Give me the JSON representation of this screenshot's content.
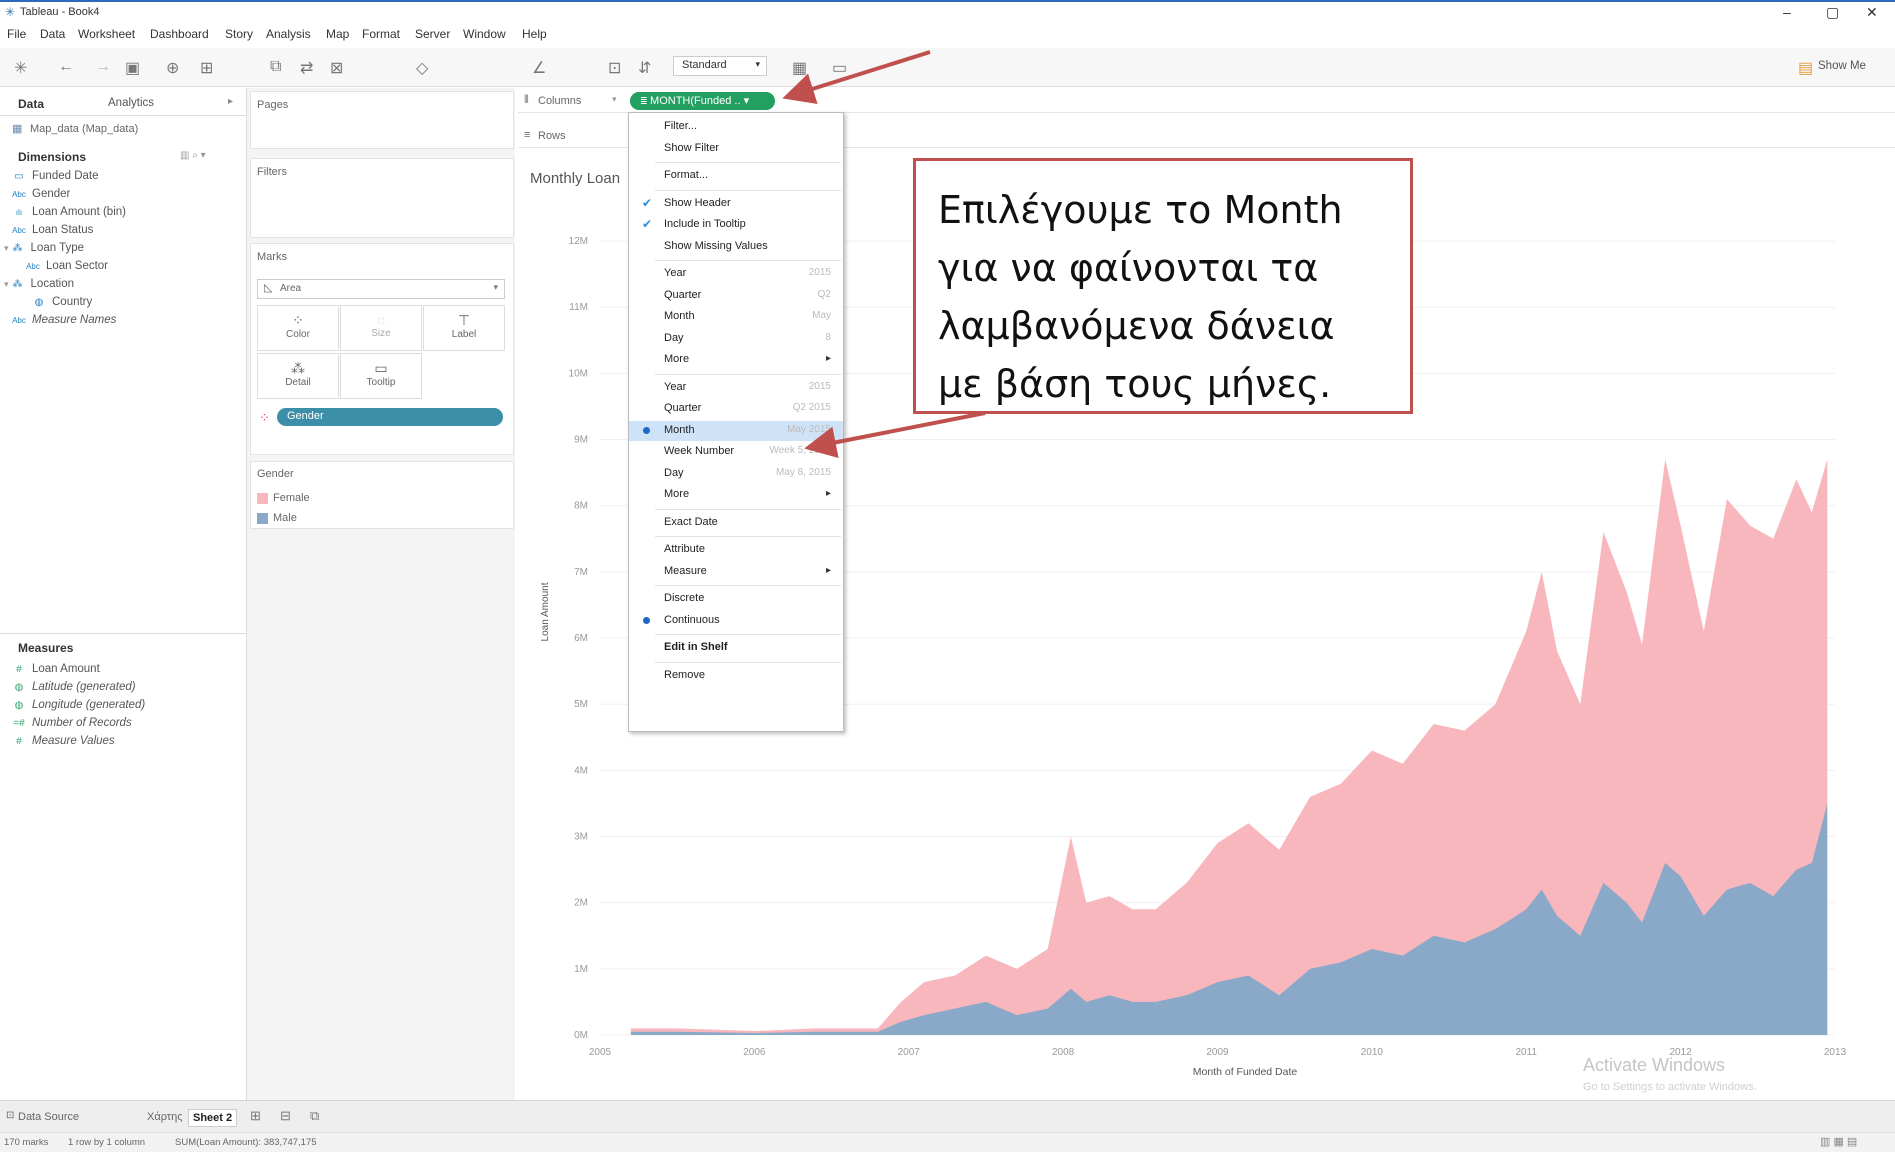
{
  "window": {
    "title": "Tableau - Book4",
    "minimize": "–",
    "maximize": "▢",
    "close": "✕"
  },
  "menu": [
    "File",
    "Data",
    "Worksheet",
    "Dashboard",
    "Story",
    "Analysis",
    "Map",
    "Format",
    "Server",
    "Window",
    "Help"
  ],
  "toolbar": {
    "fit_select": "Standard",
    "show_me": "Show Me"
  },
  "data_pane": {
    "tab_data": "Data",
    "tab_analytics": "Analytics",
    "datasource": "Map_data (Map_data)",
    "dimensions_title": "Dimensions",
    "dimensions": [
      {
        "icon": "calendar-icon",
        "glyph": "▭",
        "label": "Funded Date"
      },
      {
        "icon": "abc-icon",
        "glyph": "Abc",
        "label": "Gender"
      },
      {
        "icon": "bin-icon",
        "glyph": "ılı",
        "label": "Loan Amount (bin)"
      },
      {
        "icon": "abc-icon",
        "glyph": "Abc",
        "label": "Loan Status"
      },
      {
        "icon": "hierarchy-icon",
        "glyph": "⁂",
        "label": "Loan Type"
      },
      {
        "icon": "abc-icon",
        "glyph": "Abc",
        "label": "Loan Sector"
      },
      {
        "icon": "hierarchy-icon",
        "glyph": "⁂",
        "label": "Location"
      },
      {
        "icon": "globe-icon",
        "glyph": "◍",
        "label": "Country"
      },
      {
        "icon": "abc-icon",
        "glyph": "Abc",
        "label": "Measure Names"
      }
    ],
    "measures_title": "Measures",
    "measures": [
      {
        "icon": "hash-icon",
        "glyph": "#",
        "label": "Loan Amount"
      },
      {
        "icon": "globe-icon",
        "glyph": "◍",
        "label": "Latitude (generated)"
      },
      {
        "icon": "globe-icon",
        "glyph": "◍",
        "label": "Longitude (generated)"
      },
      {
        "icon": "hash-icon",
        "glyph": "=#",
        "label": "Number of Records"
      },
      {
        "icon": "hash-icon",
        "glyph": "#",
        "label": "Measure Values"
      }
    ]
  },
  "cards": {
    "pages": "Pages",
    "filters": "Filters",
    "marks": "Marks",
    "mark_type": "Area",
    "color": "Color",
    "size": "Size",
    "label": "Label",
    "detail": "Detail",
    "tooltip": "Tooltip",
    "gender_pill": "Gender",
    "legend_title": "Gender",
    "legend": [
      {
        "label": "Female",
        "color": "#f8b6bd"
      },
      {
        "label": "Male",
        "color": "#8aa9c8"
      }
    ]
  },
  "shelves": {
    "columns": "Columns",
    "rows": "Rows",
    "columns_pill": "MONTH(Funded ..  ▾"
  },
  "context_menu": {
    "items": [
      {
        "label": "Filter...",
        "check": ""
      },
      {
        "label": "Show Filter",
        "check": ""
      },
      {
        "label": "Format...",
        "check": ""
      },
      {
        "label": "Show Header",
        "check": "✔"
      },
      {
        "label": "Include in Tooltip",
        "check": "✔"
      },
      {
        "label": "Show Missing Values",
        "check": ""
      },
      {
        "label": "Year",
        "right": "2015"
      },
      {
        "label": "Quarter",
        "right": "Q2"
      },
      {
        "label": "Month",
        "right": "May"
      },
      {
        "label": "Day",
        "right": "8"
      },
      {
        "label": "More",
        "right": "▸"
      },
      {
        "label": "Year",
        "right": "2015"
      },
      {
        "label": "Quarter",
        "right": "Q2 2015"
      },
      {
        "label": "Month",
        "right": "May 2015",
        "selected": true
      },
      {
        "label": "Week Number",
        "right": "Week 5, 2015"
      },
      {
        "label": "Day",
        "right": "May 8, 2015"
      },
      {
        "label": "More",
        "right": "▸"
      },
      {
        "label": "Exact Date"
      },
      {
        "label": "Attribute"
      },
      {
        "label": "Measure",
        "right": "▸"
      },
      {
        "label": "Discrete"
      },
      {
        "label": "Continuous",
        "dot": true
      },
      {
        "label": "Edit in Shelf",
        "bold": true
      },
      {
        "label": "Remove"
      }
    ]
  },
  "callout": {
    "lines": [
      "Επιλέγουμε το Month",
      "για να φαίνονται τα",
      "λαμβανόμενα δάνεια",
      "με βάση τους μήνες."
    ]
  },
  "chart_data": {
    "type": "area",
    "title": "Monthly Loan",
    "xlabel": "Month of Funded Date",
    "ylabel": "Loan Amount",
    "x_ticks": [
      "2005",
      "2006",
      "2007",
      "2008",
      "2009",
      "2010",
      "2011",
      "2012",
      "2013"
    ],
    "y_ticks": [
      "0M",
      "1M",
      "2M",
      "3M",
      "4M",
      "5M",
      "6M",
      "7M",
      "8M",
      "9M",
      "10M",
      "11M",
      "12M"
    ],
    "ylim": [
      0,
      12.5
    ],
    "x": [
      2005.2,
      2005.5,
      2006.0,
      2006.4,
      2006.8,
      2006.95,
      2007.1,
      2007.3,
      2007.5,
      2007.7,
      2007.9,
      2008.05,
      2008.15,
      2008.3,
      2008.45,
      2008.6,
      2008.8,
      2009.0,
      2009.2,
      2009.4,
      2009.6,
      2009.8,
      2010.0,
      2010.2,
      2010.4,
      2010.6,
      2010.8,
      2011.0,
      2011.1,
      2011.2,
      2011.35,
      2011.5,
      2011.65,
      2011.75,
      2011.9,
      2012.0,
      2012.15,
      2012.3,
      2012.45,
      2012.6,
      2012.75,
      2012.85,
      2012.95
    ],
    "series": [
      {
        "name": "Male",
        "color": "#8aa9c8",
        "values": [
          0.05,
          0.05,
          0.03,
          0.05,
          0.05,
          0.2,
          0.3,
          0.4,
          0.5,
          0.3,
          0.4,
          0.7,
          0.5,
          0.6,
          0.5,
          0.5,
          0.6,
          0.8,
          0.9,
          0.6,
          1.0,
          1.1,
          1.3,
          1.2,
          1.5,
          1.4,
          1.6,
          1.9,
          2.2,
          1.8,
          1.5,
          2.3,
          2.0,
          1.7,
          2.6,
          2.4,
          1.8,
          2.2,
          2.3,
          2.1,
          2.5,
          2.6,
          3.5
        ]
      },
      {
        "name": "Female",
        "color": "#f8b6bd",
        "values": [
          0.05,
          0.05,
          0.03,
          0.05,
          0.05,
          0.3,
          0.5,
          0.5,
          0.7,
          0.7,
          0.9,
          2.3,
          1.5,
          1.5,
          1.4,
          1.4,
          1.7,
          2.1,
          2.3,
          2.2,
          2.6,
          2.7,
          3.0,
          2.9,
          3.2,
          3.2,
          3.4,
          4.2,
          4.8,
          4.0,
          3.5,
          5.3,
          4.7,
          4.2,
          6.1,
          5.3,
          4.3,
          5.9,
          5.4,
          5.4,
          5.9,
          5.3,
          5.2
        ]
      }
    ]
  },
  "watermark": {
    "line1": "Activate Windows",
    "line2": "Go to Settings to activate Windows."
  },
  "bottom_tabs": {
    "data_source": "Data Source",
    "sheet1": "Χάρτης",
    "sheet2": "Sheet 2"
  },
  "status": {
    "marks": "170 marks",
    "rows": "1 row by 1 column",
    "sum": "SUM(Loan Amount): 383,747,175"
  }
}
